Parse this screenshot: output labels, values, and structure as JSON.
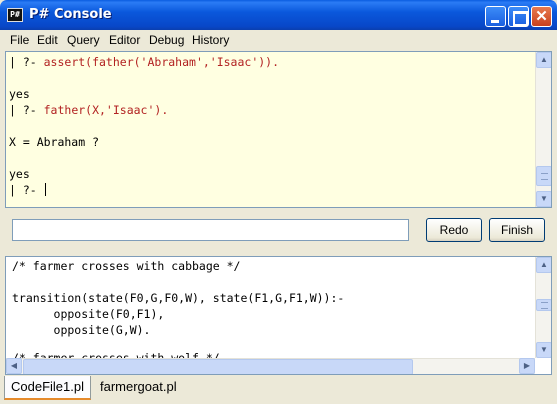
{
  "window": {
    "title": "P# Console",
    "app_icon_text": "P#"
  },
  "menu": [
    "File",
    "Edit",
    "Query",
    "Editor",
    "Debug",
    "History"
  ],
  "console": {
    "lines": [
      {
        "prompt": "| ?- ",
        "code": "assert(father('Abraham','Isaac'))."
      },
      {
        "prompt": "",
        "code": ""
      },
      {
        "prompt": "yes",
        "code": ""
      },
      {
        "prompt": "| ?- ",
        "code": "father(X,'Isaac')."
      },
      {
        "prompt": "",
        "code": ""
      },
      {
        "prompt": "X = Abraham ?",
        "code": ""
      },
      {
        "prompt": "",
        "code": ""
      },
      {
        "prompt": "yes",
        "code": ""
      },
      {
        "prompt": "| ?- ",
        "code": ""
      }
    ]
  },
  "query": {
    "value": "",
    "redo_label": "Redo",
    "finish_label": "Finish"
  },
  "editor": {
    "lines": [
      "/* farmer crosses with cabbage */",
      "",
      "transition(state(F0,G,F0,W), state(F1,G,F1,W)):-",
      "      opposite(F0,F1),",
      "      opposite(G,W).",
      "",
      "/* farmer crosses with wolf */"
    ]
  },
  "tabs": [
    {
      "label": "CodeFile1.pl",
      "active": true
    },
    {
      "label": "farmergoat.pl",
      "active": false
    }
  ],
  "colors": {
    "console_bg": "#ffffe1",
    "code_red": "#b22222",
    "titlebar_blue": "#0a58dc",
    "tab_accent": "#e68b2c"
  }
}
